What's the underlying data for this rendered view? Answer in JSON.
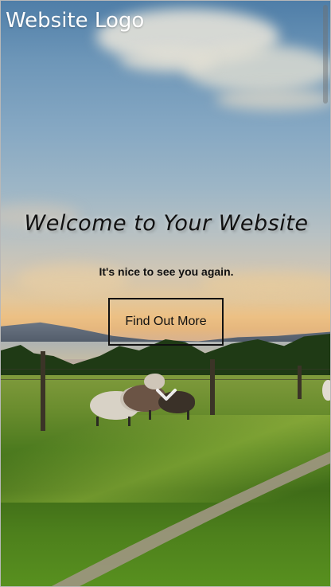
{
  "header": {
    "logo_text": "Website Logo"
  },
  "hero": {
    "title": "Welcome to Your Website",
    "subtitle": "It's nice to see you again.",
    "cta_label": "Find Out More"
  },
  "icons": {
    "scroll_down": "chevron-down-icon"
  },
  "colors": {
    "text_primary": "#111111",
    "logo_text": "#ffffff",
    "button_border": "#111111"
  }
}
